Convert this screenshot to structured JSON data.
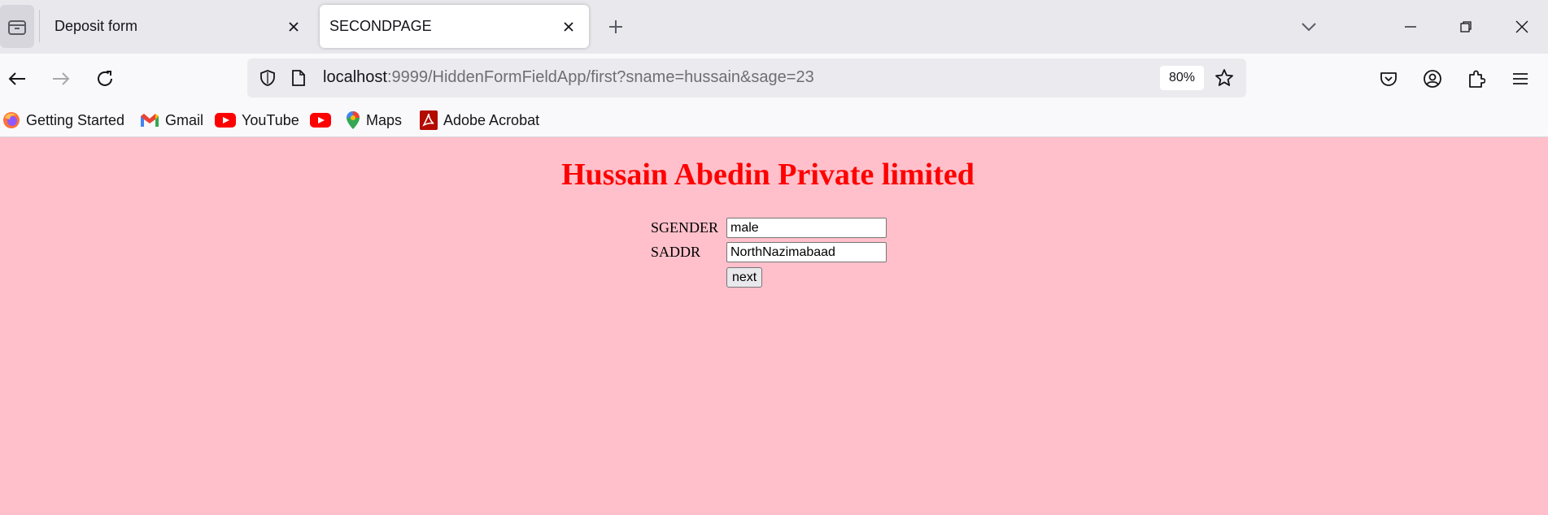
{
  "browser": {
    "tabs": [
      {
        "title": "Deposit form",
        "active": false
      },
      {
        "title": "SECONDPAGE",
        "active": true
      }
    ],
    "url": {
      "host": "localhost",
      "path": ":9999/HiddenFormFieldApp/first?sname=hussain&sage=23"
    },
    "zoom": "80%",
    "bookmarks": [
      {
        "label": "Getting Started",
        "icon": "firefox-icon"
      },
      {
        "label": "Gmail",
        "icon": "gmail-icon"
      },
      {
        "label": "YouTube",
        "icon": "youtube-icon"
      },
      {
        "label": "",
        "icon": "youtube-icon"
      },
      {
        "label": "Maps",
        "icon": "maps-pin-icon"
      },
      {
        "label": "Adobe Acrobat",
        "icon": "adobe-acrobat-icon"
      }
    ]
  },
  "page": {
    "background": "#ffc0cb",
    "heading": "Hussain Abedin Private limited",
    "heading_color": "#ff0000",
    "form": {
      "gender_label": "SGENDER",
      "gender_value": "male",
      "address_label": "SADDR",
      "address_value": "NorthNazimabaad",
      "submit_label": "next"
    }
  }
}
